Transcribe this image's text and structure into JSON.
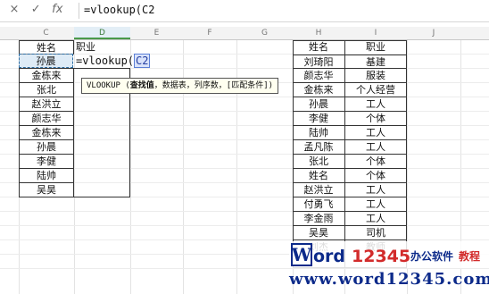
{
  "formula_bar": {
    "icons": [
      "close-icon",
      "check-icon",
      "fx-icon"
    ],
    "icon_glyphs": [
      "×",
      "✓",
      "fx"
    ],
    "formula": "=vlookup(C2"
  },
  "columns": [
    "C",
    "D",
    "E",
    "F",
    "G",
    "H",
    "I",
    "J"
  ],
  "left_table": {
    "header": "姓名",
    "rows": [
      "孙晨",
      "金栋来",
      "张北",
      "赵洪立",
      "颜志华",
      "金栋来",
      "孙晨",
      "李健",
      "陆帅",
      "吴昊"
    ]
  },
  "d_column": {
    "header": "职业",
    "formula_prefix": "=vlookup(",
    "formula_ref": "C2"
  },
  "tooltip": {
    "fn": "VLOOKUP",
    "open": " (",
    "bold_arg": "查找值",
    "rest": "，数据表，列序数，[匹配条件])"
  },
  "right_table": {
    "headers": [
      "姓名",
      "职业"
    ],
    "rows": [
      [
        "刘琦阳",
        "基建"
      ],
      [
        "颜志华",
        "服装"
      ],
      [
        "金栋来",
        "个人经营"
      ],
      [
        "孙晨",
        "工人"
      ],
      [
        "李健",
        "个体"
      ],
      [
        "陆帅",
        "工人"
      ],
      [
        "孟凡陈",
        "工人"
      ],
      [
        "张北",
        "个体"
      ],
      [
        "姓名",
        "个体"
      ],
      [
        "赵洪立",
        "工人"
      ],
      [
        "付勇飞",
        "工人"
      ],
      [
        "李金雨",
        "工人"
      ],
      [
        "吴昊",
        "司机"
      ],
      [
        "刘杰",
        "教师"
      ]
    ]
  },
  "watermark": {
    "brand": "Word12345",
    "tagline": "办公软件",
    "tagline2": "教程",
    "url": "www.word12345.com"
  },
  "colors": {
    "active_header": "#e3eef6",
    "ref_blue": "#5a7fd6",
    "brand_red": "#d22b2b",
    "brand_navy": "#0c2a8a"
  }
}
